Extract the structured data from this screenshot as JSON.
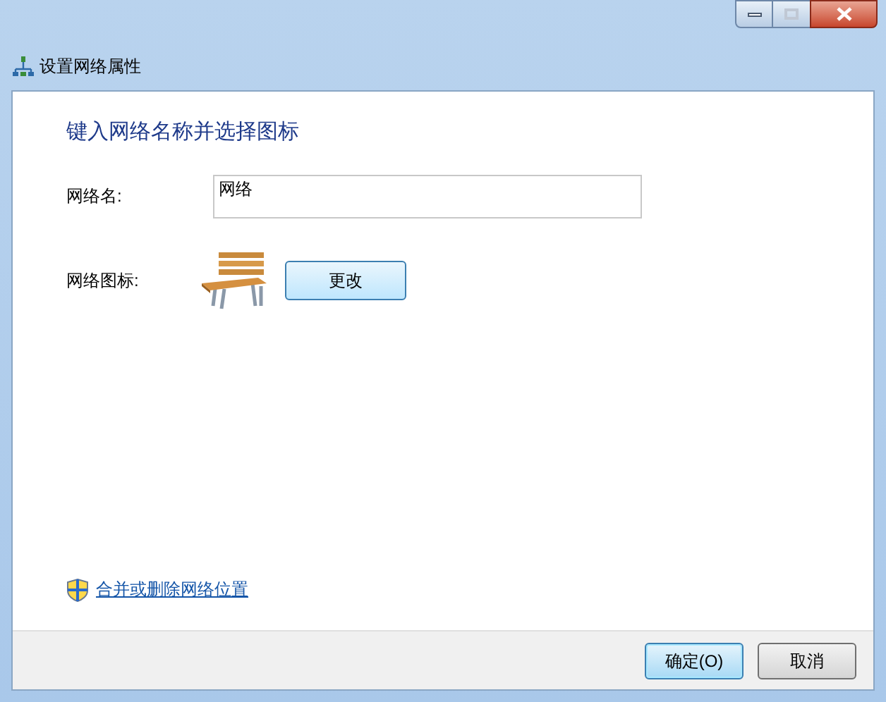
{
  "window": {
    "title": "设置网络属性"
  },
  "heading": "键入网络名称并选择图标",
  "name_field": {
    "label": "网络名:",
    "value": "网络"
  },
  "icon_row": {
    "label": "网络图标:",
    "button": "更改"
  },
  "link": "合并或删除网络位置",
  "buttons": [
    {
      "label": "确定(O)",
      "default": true
    },
    {
      "label": "取消",
      "default": false
    }
  ]
}
